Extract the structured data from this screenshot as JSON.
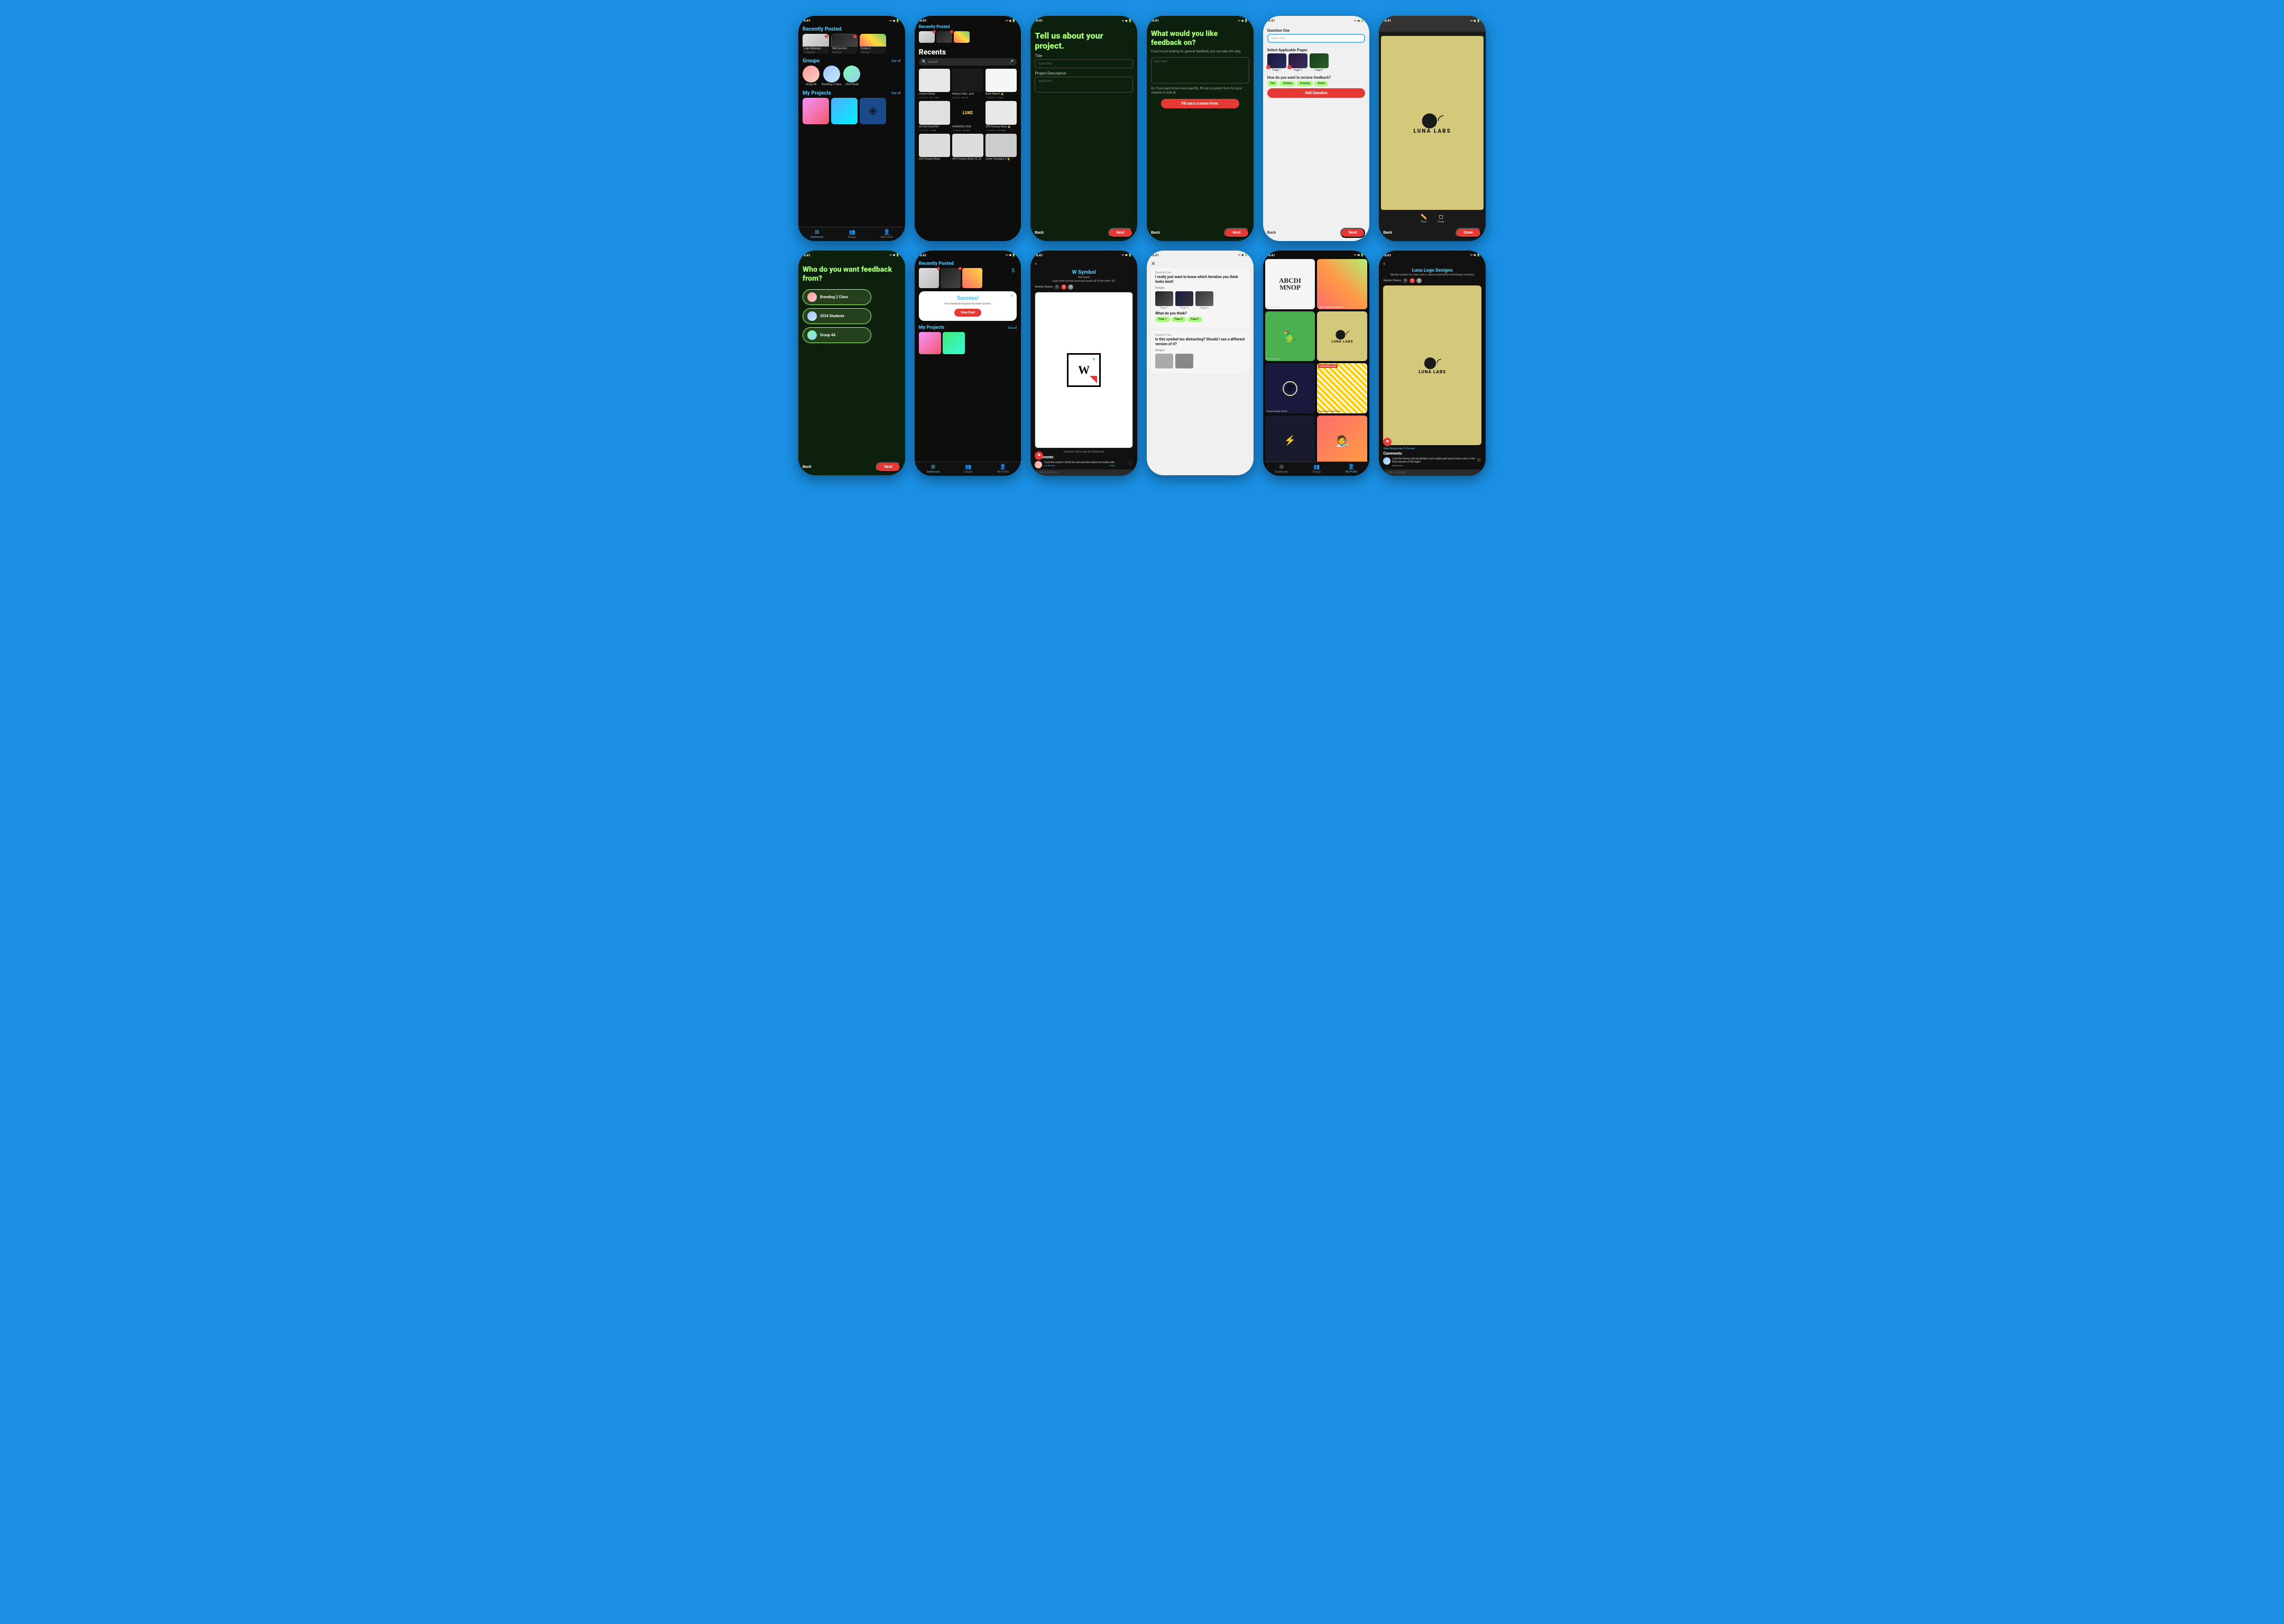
{
  "app": {
    "title": "Design App UI Screenshots"
  },
  "screens": {
    "row1": [
      {
        "id": "screen1",
        "type": "dashboard",
        "status_time": "9:41",
        "recently_posted_title": "Recently Posted",
        "cards": [
          {
            "label": "Logo Redesign",
            "sub": "Leo Browne",
            "class_name": "Branding 2 Class",
            "type": "logo"
          },
          {
            "label": "Web Symbol",
            "sub": "Mia Green",
            "class_name": "2024 Students",
            "type": "web"
          },
          {
            "label": "Poster S",
            "sub": "Alex Gray",
            "class_name": "Group 4a",
            "type": "poster"
          }
        ],
        "groups_title": "Groups",
        "see_all": "See all",
        "groups": [
          {
            "name": "Group 4A",
            "type": "g1"
          },
          {
            "name": "Branding 2 Class",
            "type": "g2"
          },
          {
            "name": "2024 Stude",
            "type": "g3"
          }
        ],
        "projects_title": "My Projects",
        "nav": [
          "Dashboard",
          "Groups",
          "My Profile"
        ]
      },
      {
        "id": "screen2",
        "type": "file-browser",
        "status_time": "9:41",
        "recently_posted_title": "Recently Posted",
        "recents_title": "Recents",
        "search_placeholder": "Search",
        "files": [
          {
            "name": "Lecture Notes",
            "date": "12/11/23",
            "size": "767.7 MB",
            "type": "lecture"
          },
          {
            "name": "Kathryn Haw...port",
            "date": "12/8/23",
            "size": "340 KB",
            "type": "hawkins"
          },
          {
            "name": "Book Report",
            "date": "11/25/23",
            "size": "115 KB",
            "type": "book"
          },
          {
            "name": "UX Site Final PDF",
            "date": "11/17/23",
            "size": "1.9 MB",
            "type": "ux"
          },
          {
            "name": "HAWKINS LOGO",
            "date": "11/13/23",
            "size": "935 KB",
            "type": "logo-dark"
          },
          {
            "name": "245 Process Book",
            "date": "11/10/23",
            "size": "444.3 MB",
            "type": "process"
          },
          {
            "name": "243 Process Book",
            "date": "",
            "size": "",
            "type": "process2"
          },
          {
            "name": "243 Process Book V2_26",
            "date": "",
            "size": "",
            "type": "process2"
          },
          {
            "name": "Cover Concepts 3",
            "date": "",
            "size": "",
            "type": "cover"
          }
        ]
      },
      {
        "id": "screen3",
        "type": "project-form",
        "status_time": "9:41",
        "hero_text": "Tell us about your project.",
        "title_label": "Title",
        "title_placeholder": "Input text",
        "description_label": "Project Description",
        "description_placeholder": "Input text",
        "btn_back": "Back",
        "btn_next": "Next"
      },
      {
        "id": "screen4",
        "type": "feedback-question",
        "status_time": "9:41",
        "hero_text": "What would you like feedback on?",
        "sub_text": "If you're just looking for general feedback, you can skip this step.",
        "input_placeholder": "Input text",
        "or_text": "Or, if you want to be more specific, fill out a custom form for your viewers to look at.",
        "custom_form_label": "Fill out a custom form.",
        "btn_back": "Back",
        "btn_next": "Next"
      },
      {
        "id": "screen5",
        "type": "question-builder",
        "status_time": "9:41",
        "question_label": "Question One",
        "input_placeholder": "Input text",
        "pages_label": "Select Applicable Pages",
        "pages": [
          "Page 1",
          "Page 2",
          "Page 3"
        ],
        "feedback_label": "How do you want to recieve feedback?",
        "feedback_types": [
          "Poll",
          "Textbox",
          "Drawing",
          "Select"
        ],
        "add_question_label": "Add Question",
        "btn_back": "Back",
        "btn_next": "Next"
      },
      {
        "id": "screen6",
        "type": "drawing-canvas",
        "status_time": "9:41",
        "luna_text": "LUNA LABS",
        "draw_label": "Draw",
        "erase_label": "Erase",
        "btn_back": "Back",
        "btn_done": "Done"
      }
    ],
    "row2": [
      {
        "id": "screen7",
        "type": "feedback-audience",
        "status_time": "9:41",
        "hero_text": "Who do you want feedback from?",
        "groups": [
          {
            "name": "Branding 2 Class",
            "type": "g1"
          },
          {
            "name": "2024 Students",
            "type": "g2"
          },
          {
            "name": "Group 4A",
            "type": "g3"
          }
        ],
        "btn_back": "Back",
        "btn_next": "Next"
      },
      {
        "id": "screen8",
        "type": "success-dashboard",
        "status_time": "9:41",
        "recently_posted_title": "Recently Posted",
        "success_title": "Success!",
        "success_sub": "Your feedback request has been posted.",
        "view_post_label": "View Post",
        "projects_title": "My Projects",
        "see_all": "See all",
        "nav": [
          "Dashboard",
          "Groups",
          "My Profile"
        ]
      },
      {
        "id": "screen9",
        "type": "post-view",
        "status_time": "9:41",
        "post_title": "W Symbol",
        "post_author": "Mia Green",
        "post_desc": "Logo mark/symbol exercise based off of the letter \"W\".",
        "version_label": "Version History",
        "versions": [
          "1",
          "2",
          "3"
        ],
        "designer_note": "Designer wants specific feedbacks",
        "comments_title": "Comments:",
        "comment_text": "I love the colors! I think the red and blue stand out really well.",
        "comment_author": "Leo Browne",
        "comment_reply": "Reply",
        "add_comment_placeholder": "Add a comment"
      },
      {
        "id": "screen10",
        "type": "feedback-form",
        "status_time": "9:41",
        "question1_label": "Question One",
        "question1_text": "I really just want to know which iteration you think looks best!",
        "designs_label": "Designs",
        "designs": [
          "Page 1",
          "Page 2",
          "Page 3"
        ],
        "what_think_label": "What do you think?",
        "page_options": [
          "Page 1",
          "Page 2",
          "Page 3"
        ],
        "question2_label": "Question Two",
        "question2_text": "Is this symbol too distracting? Should I use a different version of it?"
      },
      {
        "id": "screen11",
        "type": "portfolio-grid",
        "status_time": "9:41",
        "items": [
          {
            "label": "Typeface Test",
            "type": "typeface"
          },
          {
            "label": "Type Overprinting Exercise",
            "type": "overprint"
          },
          {
            "label": "Bird Illustration",
            "type": "bird"
          },
          {
            "label": "Luna Logo Designs",
            "type": "luna"
          },
          {
            "label": "\"Learn Visually\" Sticker",
            "type": "learn"
          },
          {
            "label": "Photography Slideshow",
            "type": "construction"
          },
          {
            "label": "",
            "type": "sticker"
          },
          {
            "label": "",
            "type": "person"
          }
        ],
        "nav": [
          "Dashboard",
          "Groups",
          "My Profile"
        ]
      },
      {
        "id": "screen12",
        "type": "post-view-luna",
        "status_time": "9:41",
        "post_title": "Luna Logo Designs",
        "post_desc": "Identity system for Luna Labs, a space exploration technology company.",
        "version_label": "Version History",
        "versions": [
          "1",
          "2",
          "3"
        ],
        "view_responses": "View Responses To Survey",
        "comments_title": "Comments:",
        "comment_text": "Love the forms and symbolism, but maybe add some more color to the final version of the logo?",
        "comment_author": "Mia Greene",
        "add_comment_placeholder": "Add a comment"
      }
    ]
  }
}
